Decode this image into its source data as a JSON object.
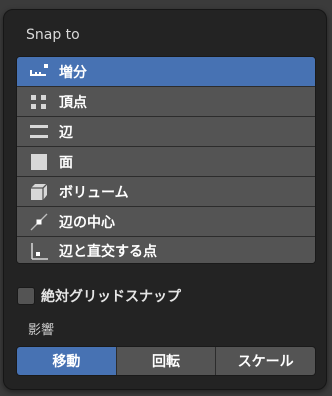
{
  "panel": {
    "header": "Snap to",
    "snap_items": [
      {
        "label": "増分",
        "icon": "increment-icon",
        "active": true
      },
      {
        "label": "頂点",
        "icon": "vertex-icon",
        "active": false
      },
      {
        "label": "辺",
        "icon": "edge-icon",
        "active": false
      },
      {
        "label": "面",
        "icon": "face-icon",
        "active": false
      },
      {
        "label": "ボリューム",
        "icon": "volume-icon",
        "active": false
      },
      {
        "label": "辺の中心",
        "icon": "edge-center-icon",
        "active": false
      },
      {
        "label": "辺と直交する点",
        "icon": "edge-perpendicular-icon",
        "active": false
      }
    ],
    "absolute_grid_snap": {
      "label": "絶対グリッドスナップ",
      "checked": false
    },
    "affect_label": "影響",
    "affect_buttons": [
      {
        "label": "移動",
        "active": true
      },
      {
        "label": "回転",
        "active": false
      },
      {
        "label": "スケール",
        "active": false
      }
    ]
  },
  "colors": {
    "accent": "#4772b3",
    "item_bg": "#545454",
    "panel_bg": "#232323"
  }
}
